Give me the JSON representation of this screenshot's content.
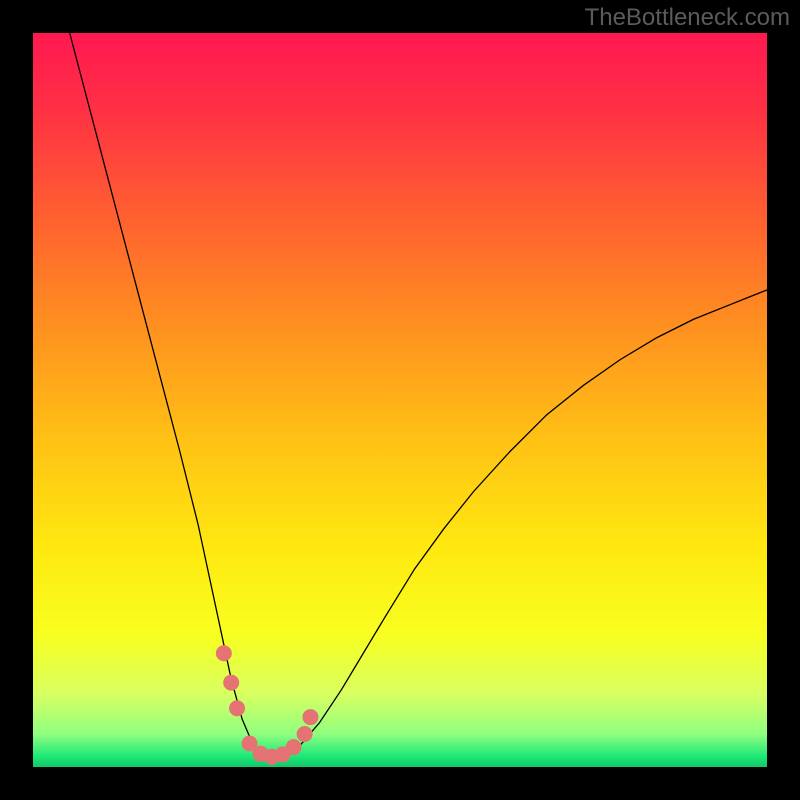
{
  "watermark": "TheBottleneck.com",
  "chart_data": {
    "type": "line",
    "title": "",
    "xlabel": "",
    "ylabel": "",
    "xlim": [
      0,
      100
    ],
    "ylim": [
      0,
      100
    ],
    "background_gradient": {
      "stops": [
        {
          "offset": 0.0,
          "color": "#ff1850"
        },
        {
          "offset": 0.1,
          "color": "#ff2f45"
        },
        {
          "offset": 0.25,
          "color": "#ff6030"
        },
        {
          "offset": 0.4,
          "color": "#ff9020"
        },
        {
          "offset": 0.55,
          "color": "#ffc015"
        },
        {
          "offset": 0.7,
          "color": "#ffe810"
        },
        {
          "offset": 0.82,
          "color": "#f8ff20"
        },
        {
          "offset": 0.9,
          "color": "#d8ff60"
        },
        {
          "offset": 0.955,
          "color": "#90ff80"
        },
        {
          "offset": 0.985,
          "color": "#20e878"
        },
        {
          "offset": 1.0,
          "color": "#10c868"
        }
      ]
    },
    "series": [
      {
        "name": "bottleneck-curve",
        "type": "line",
        "color": "#000000",
        "width": 1.3,
        "x": [
          5.0,
          7.5,
          10.0,
          12.5,
          15.0,
          17.5,
          20.0,
          22.5,
          24.0,
          25.5,
          27.0,
          28.5,
          30.0,
          31.5,
          33.0,
          34.5,
          36.0,
          39.0,
          42.0,
          45.0,
          48.0,
          52.0,
          56.0,
          60.0,
          65.0,
          70.0,
          75.0,
          80.0,
          85.0,
          90.0,
          95.0,
          100.0
        ],
        "values": [
          100.0,
          90.5,
          81.0,
          71.5,
          62.0,
          52.5,
          43.0,
          33.0,
          26.0,
          19.0,
          12.0,
          6.5,
          3.0,
          1.5,
          1.2,
          1.5,
          2.5,
          6.0,
          10.5,
          15.5,
          20.5,
          27.0,
          32.5,
          37.5,
          43.0,
          48.0,
          52.0,
          55.5,
          58.5,
          61.0,
          63.0,
          65.0
        ]
      },
      {
        "name": "minimum-markers",
        "type": "scatter",
        "color": "#e57373",
        "radius": 8,
        "x": [
          26.0,
          27.0,
          27.8,
          29.5,
          31.0,
          32.5,
          34.0,
          35.5,
          37.0,
          37.8
        ],
        "values": [
          15.5,
          11.5,
          8.0,
          3.2,
          1.8,
          1.4,
          1.7,
          2.7,
          4.5,
          6.8
        ]
      }
    ]
  }
}
